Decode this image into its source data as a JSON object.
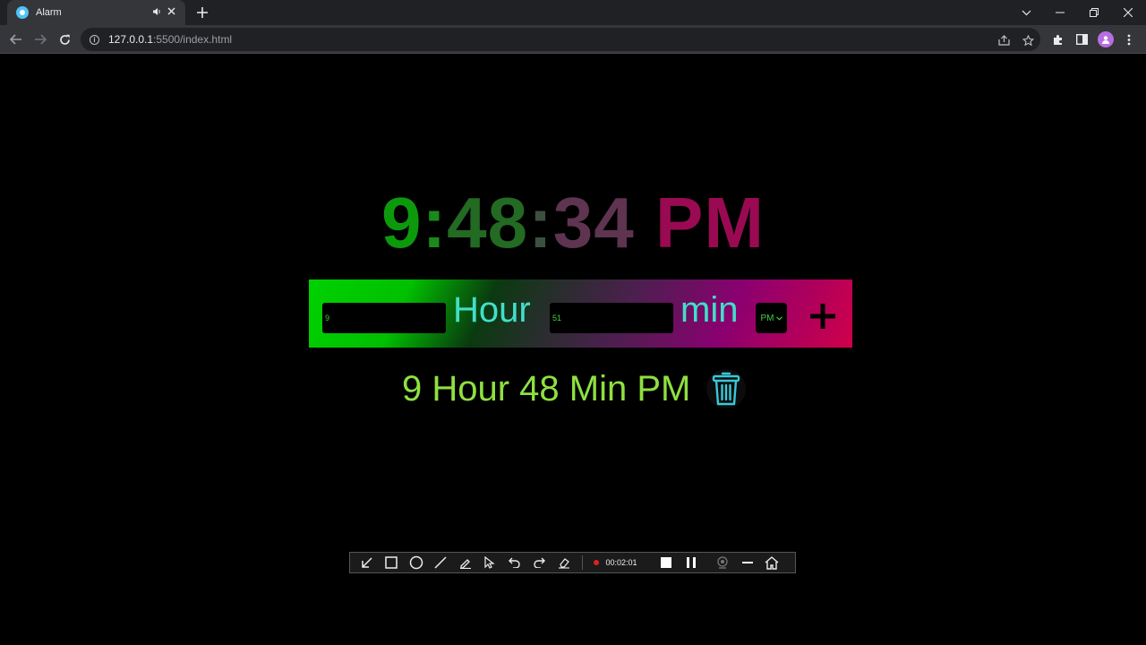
{
  "browser": {
    "tab_title": "Alarm",
    "url_host": "127.0.0.1",
    "url_rest": ":5500/index.html"
  },
  "clock": {
    "hours": "9",
    "sep1": ":",
    "minutes": "48",
    "sep2": ":",
    "seconds": "34",
    "period": "PM"
  },
  "alarm_form": {
    "hour_value": "9",
    "hour_label": "Hour",
    "minute_value": "51",
    "minute_label": "min",
    "period_selected": "PM",
    "add_symbol": "+"
  },
  "alarms": [
    {
      "text": "9 Hour 48 Min PM"
    }
  ],
  "recorder": {
    "elapsed": "00:02:01"
  },
  "colors": {
    "clock_gradient": [
      "#0c8a0c",
      "#2a6a2a",
      "#4a3a48",
      "#7a2050",
      "#a00048"
    ],
    "label_teal": "#40e0c8",
    "alarm_text": "#8ee040",
    "trash": "#38c8d8"
  }
}
